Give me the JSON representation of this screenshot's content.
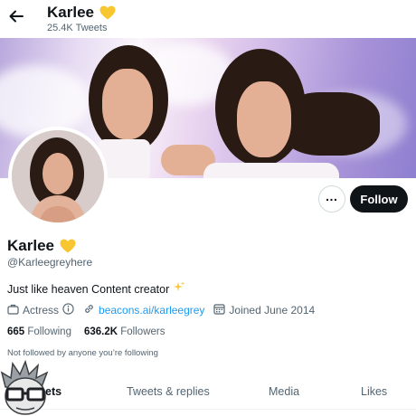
{
  "header": {
    "name": "Karlee",
    "tweets_count": "25.4K Tweets",
    "icons": [
      "back-arrow-icon",
      "yellow-heart-icon"
    ]
  },
  "profile": {
    "name": "Karlee",
    "handle": "@Karleegreyhere",
    "bio": "Just like heaven Content creator",
    "bio_emoji_icon": "sparkles-icon",
    "category": "Actress",
    "link": "beacons.ai/karleegrey",
    "joined": "Joined June 2014",
    "following_count": "665",
    "following_label": "Following",
    "followers_count": "636.2K",
    "followers_label": "Followers",
    "not_followed_text": "Not followed by anyone you’re following"
  },
  "actions": {
    "follow_label": "Follow",
    "more_label": "…"
  },
  "tabs": [
    {
      "label": "ets",
      "active": true
    },
    {
      "label": "Tweets & replies",
      "active": false
    },
    {
      "label": "Media",
      "active": false
    },
    {
      "label": "Likes",
      "active": false
    }
  ],
  "colors": {
    "accent": "#1d9bf0",
    "text_primary": "#0f1419",
    "text_secondary": "#536471",
    "heart": "#f7c631",
    "follow_button_bg": "#0f1419"
  }
}
